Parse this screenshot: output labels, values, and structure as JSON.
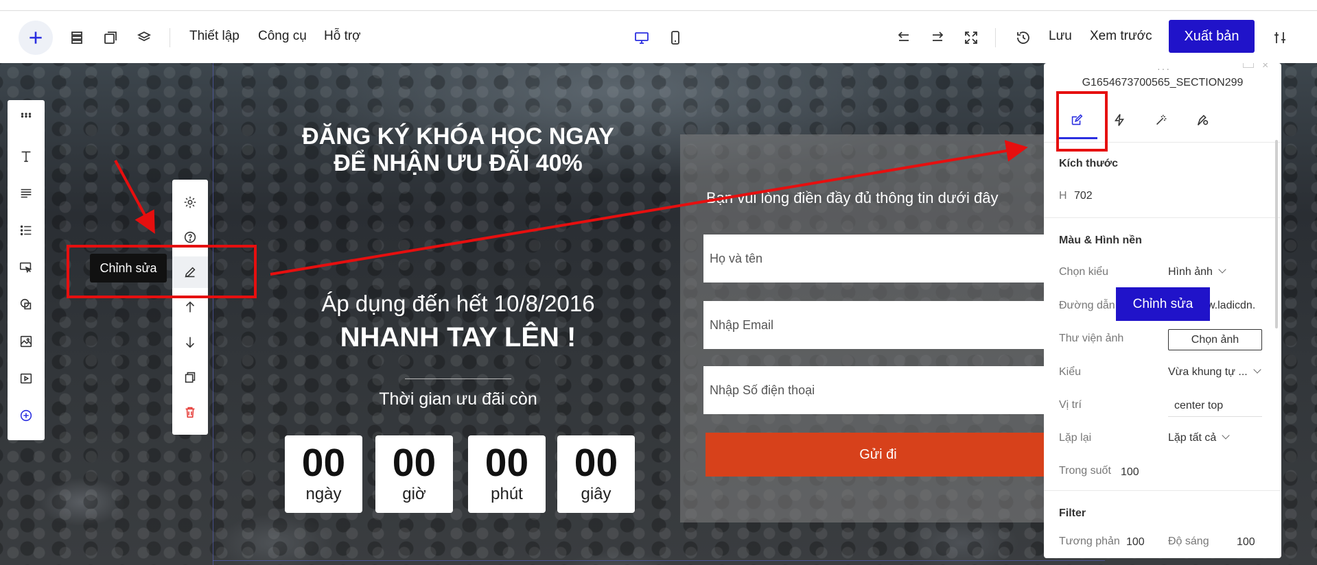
{
  "header": {
    "menu": [
      "Thiết lập",
      "Công cụ",
      "Hỗ trợ"
    ],
    "save_label": "Lưu",
    "preview_label": "Xem trước",
    "publish_label": "Xuất bản",
    "accent": "#2013c9"
  },
  "hero": {
    "headline_line1": "ĐĂNG KÝ KHÓA HỌC NGAY",
    "headline_line2": "ĐỂ NHẬN ƯU ĐÃI 40%",
    "apply_text": "Áp dụng đến hết 10/8/2016",
    "hurry_text": "NHANH TAY LÊN !",
    "countdown_title": "Thời gian ưu đãi còn",
    "countdown": [
      {
        "value": "00",
        "label": "ngày"
      },
      {
        "value": "00",
        "label": "giờ"
      },
      {
        "value": "00",
        "label": "phút"
      },
      {
        "value": "00",
        "label": "giây"
      }
    ]
  },
  "form": {
    "title": "Bạn vui lòng điền đầy đủ thông tin dưới đây",
    "fields": [
      "Họ và tên",
      "Nhập Email",
      "Nhập Số điện thoại"
    ],
    "submit_label": "Gửi đi",
    "submit_color": "#d7411b"
  },
  "tooltip": "Chỉnh sửa",
  "panel": {
    "title": "G1654673700565_SECTION299",
    "size_section": "Kích thước",
    "height_label": "H",
    "height_value": "702",
    "bg_section": "Màu & Hình nền",
    "rows": {
      "type_label": "Chọn kiểu",
      "type_value": "Hình ảnh",
      "path_label": "Đường dẫn",
      "path_value": "w.ladicdn.",
      "library_label": "Thư viện ảnh",
      "library_button": "Chọn ảnh",
      "style_label": "Kiểu",
      "style_value": "Vừa khung tự ...",
      "position_label": "Vị trí",
      "position_value": "center top",
      "repeat_label": "Lặp lại",
      "repeat_value": "Lặp tất cả",
      "opacity_label": "Trong suốt",
      "opacity_value": "100"
    },
    "filter_section": "Filter",
    "contrast_label": "Tương phản",
    "contrast_value": "100",
    "brightness_label": "Độ sáng",
    "brightness_value": "100",
    "edit_tag": "Chỉnh sửa"
  },
  "annotation_color": "#e60f0f"
}
